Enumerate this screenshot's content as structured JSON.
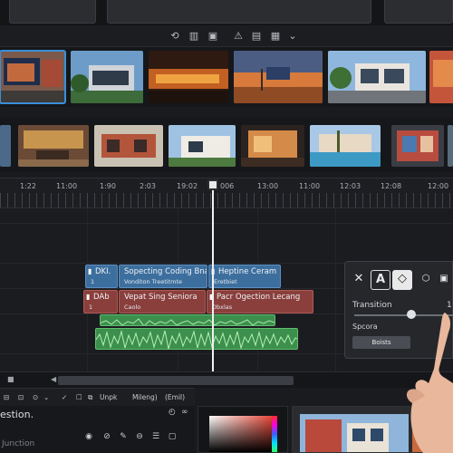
{
  "toolbar": {
    "icons": [
      "loop-icon",
      "level-meter-icon",
      "snapshot-icon",
      "warning-icon",
      "caption-icon",
      "storyboard-icon",
      "chevron-down-icon"
    ]
  },
  "ruler": {
    "ticks": [
      "1:22",
      "11:00",
      "1:90",
      "2:03",
      "19:02",
      "006",
      "13:00",
      "11:00",
      "12:03",
      "12:08",
      "12:00"
    ]
  },
  "tracks": {
    "title_track": [
      {
        "title": "DKI.",
        "sub": "1"
      },
      {
        "title": "Sopecting Coding Bnact",
        "sub": "Vonditon Treetitmte"
      },
      {
        "title": "Heptine Ceram",
        "sub": "Eretbiet"
      }
    ],
    "fx_track": [
      {
        "title": "DAb",
        "sub": "1"
      },
      {
        "title": "Vepat Sing Seniora",
        "sub": "Caolo"
      },
      {
        "title": "Pacr Ogection Lecang",
        "sub": "Dbxlas"
      }
    ]
  },
  "inspector": {
    "transition_label": "Transition",
    "transition_value": "1",
    "transition_level": 0.57,
    "section_label": "Spcora",
    "reset_label": "Boists"
  },
  "bottom_bar": {
    "unpk_label": "Unpk",
    "mileng_label": "Mileng)",
    "email_label": "(Emil)"
  },
  "bottom_left": {
    "question_text": "estion.",
    "watermark": "Junction"
  },
  "colors": {
    "accent_blue": "#3a8fd9",
    "clip_blue": "#3d6f9e",
    "clip_red": "#8a3f3c",
    "audio_green": "#3c8f4c"
  }
}
